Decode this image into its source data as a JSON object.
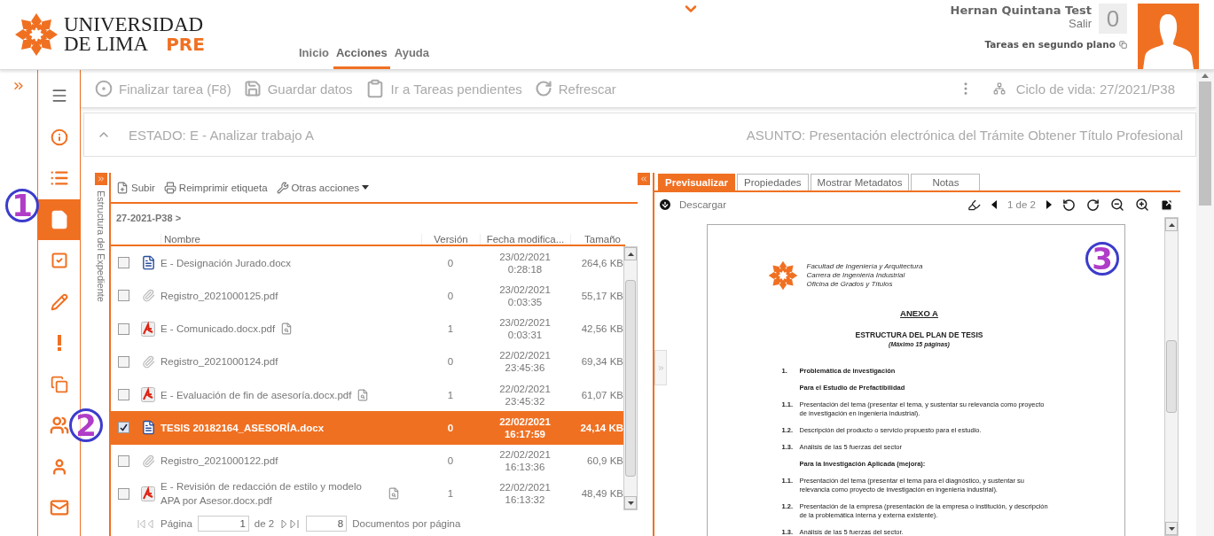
{
  "header": {
    "logo": {
      "line1": "UNIVERSIDAD",
      "line2": "DE LIMA",
      "suffix": "PRE"
    },
    "nav": [
      {
        "label": "Inicio",
        "selected": false
      },
      {
        "label": "Acciones",
        "selected": true
      },
      {
        "label": "Ayuda",
        "selected": false
      }
    ],
    "user": {
      "name": "Hernan Quintana Test",
      "logout": "Salir",
      "counter": "0",
      "background_tasks": "Tareas en segundo plano"
    }
  },
  "sidebar": {
    "items": [
      {
        "kind": "menu",
        "selected": false
      },
      {
        "kind": "info",
        "selected": false
      },
      {
        "kind": "list",
        "selected": false
      },
      {
        "kind": "document",
        "selected": true
      },
      {
        "kind": "check",
        "selected": false
      },
      {
        "kind": "pencil",
        "selected": false
      },
      {
        "kind": "alert",
        "selected": false
      },
      {
        "kind": "copy",
        "selected": false
      },
      {
        "kind": "group",
        "selected": false
      },
      {
        "kind": "person",
        "selected": false
      },
      {
        "kind": "mail",
        "selected": false
      }
    ]
  },
  "toolbar": {
    "actions": [
      {
        "kind": "finish",
        "label": "Finalizar tarea (F8)"
      },
      {
        "kind": "save",
        "label": "Guardar datos"
      },
      {
        "kind": "pending",
        "label": "Ir a Tareas pendientes"
      },
      {
        "kind": "refresh",
        "label": "Refrescar"
      }
    ],
    "lifecycle": "Ciclo de vida: 27/2021/P38"
  },
  "status": {
    "state": "ESTADO: E - Analizar trabajo A",
    "subject": "ASUNTO: Presentación electrónica del Trámite Obtener Título Profesional"
  },
  "files": {
    "side_tab": "Estructura del Expediente",
    "actions": [
      {
        "kind": "upload",
        "label": "Subir"
      },
      {
        "kind": "print",
        "label": "Reimprimir etiqueta"
      },
      {
        "kind": "tools",
        "label": "Otras acciones"
      }
    ],
    "breadcrumb": "27-2021-P38 >",
    "columns": [
      "Nombre",
      "Versión",
      "Fecha modifica...",
      "Tamaño"
    ],
    "rows": [
      {
        "kind": "word",
        "name": "E - Designación Jurado.docx",
        "version": "0",
        "date": "23/02/2021",
        "time": "0:28:18",
        "size": "264,6 KB",
        "checked": false,
        "selected": false,
        "preview": false
      },
      {
        "kind": "attachment",
        "name": "Registro_2021000125.pdf",
        "version": "0",
        "date": "23/02/2021",
        "time": "0:03:35",
        "size": "55,17 KB",
        "checked": false,
        "selected": false,
        "preview": false
      },
      {
        "kind": "pdf",
        "name": "E - Comunicado.docx.pdf",
        "version": "1",
        "date": "23/02/2021",
        "time": "0:03:31",
        "size": "42,56 KB",
        "checked": false,
        "selected": false,
        "preview": true
      },
      {
        "kind": "attachment",
        "name": "Registro_2021000124.pdf",
        "version": "0",
        "date": "22/02/2021",
        "time": "23:45:36",
        "size": "69,34 KB",
        "checked": false,
        "selected": false,
        "preview": false
      },
      {
        "kind": "pdf",
        "name": "E - Evaluación de fin de asesoría.docx.pdf",
        "version": "1",
        "date": "22/02/2021",
        "time": "23:45:32",
        "size": "61,07 KB",
        "checked": false,
        "selected": false,
        "preview": true
      },
      {
        "kind": "word",
        "name": "TESIS 20182164_ASESORÍA.docx",
        "version": "0",
        "date": "22/02/2021",
        "time": "16:17:59",
        "size": "24,14 KB",
        "checked": true,
        "selected": true,
        "preview": false
      },
      {
        "kind": "attachment",
        "name": "Registro_2021000122.pdf",
        "version": "0",
        "date": "22/02/2021",
        "time": "16:13:36",
        "size": "60,9 KB",
        "checked": false,
        "selected": false,
        "preview": false
      },
      {
        "kind": "pdf",
        "name": "E - Revisión de redacción de estilo y modelo APA por Asesor.docx.pdf",
        "version": "1",
        "date": "22/02/2021",
        "time": "16:13:32",
        "size": "48,49 KB",
        "checked": false,
        "selected": false,
        "preview": true
      }
    ],
    "pagination": {
      "page_label": "Página",
      "page": "1",
      "of": "de 2",
      "per_page": "8",
      "per_page_label": "Documentos por página"
    }
  },
  "preview": {
    "tabs": [
      {
        "label": "Previsualizar",
        "selected": true
      },
      {
        "label": "Propiedades",
        "selected": false
      },
      {
        "label": "Mostrar Metadatos",
        "selected": false
      },
      {
        "label": "Notas",
        "selected": false
      }
    ],
    "download": "Descargar",
    "page": "1 de 2",
    "document": {
      "letterhead": [
        "Facultad de Ingeniería y Arquitectura",
        "Carrera de Ingeniería Industrial",
        "Oficina de Grados y Títulos"
      ],
      "title": "ANEXO A",
      "subtitle": "ESTRUCTURA DEL PLAN DE TESIS",
      "note": "(Máximo 15 páginas)",
      "items": [
        {
          "number": "1.",
          "text": "Problemática de investigación",
          "bold": true
        },
        {
          "text": "Para el Estudio de Prefactibilidad",
          "bold": true
        },
        {
          "number": "1.1.",
          "text": "Presentación del tema (presentar el tema, y sustentar su relevancia como proyecto de investigación en ingeniería industrial).",
          "bold": false
        },
        {
          "number": "1.2.",
          "text": "Descripción del producto o servicio propuesto para el estudio.",
          "bold": false
        },
        {
          "number": "1.3.",
          "text": "Análisis de las 5 fuerzas del sector",
          "bold": false
        },
        {
          "text": "Para la Investigación Aplicada (mejora):",
          "bold": true
        },
        {
          "number": "1.1.",
          "text": "Presentación del tema (presentar el tema para el diagnóstico, y sustentar su relevancia como proyecto de investigación en ingeniería industrial).",
          "bold": false
        },
        {
          "number": "1.2.",
          "text": "Presentación de la empresa (presentación de la empresa o institución, y descripción de la problemática interna y externa existente).",
          "bold": false
        },
        {
          "number": "1.3.",
          "text": "Análisis de las 5 fuerzas del sector.",
          "bold": false
        }
      ]
    }
  },
  "annotations": [
    "1",
    "2",
    "3"
  ]
}
